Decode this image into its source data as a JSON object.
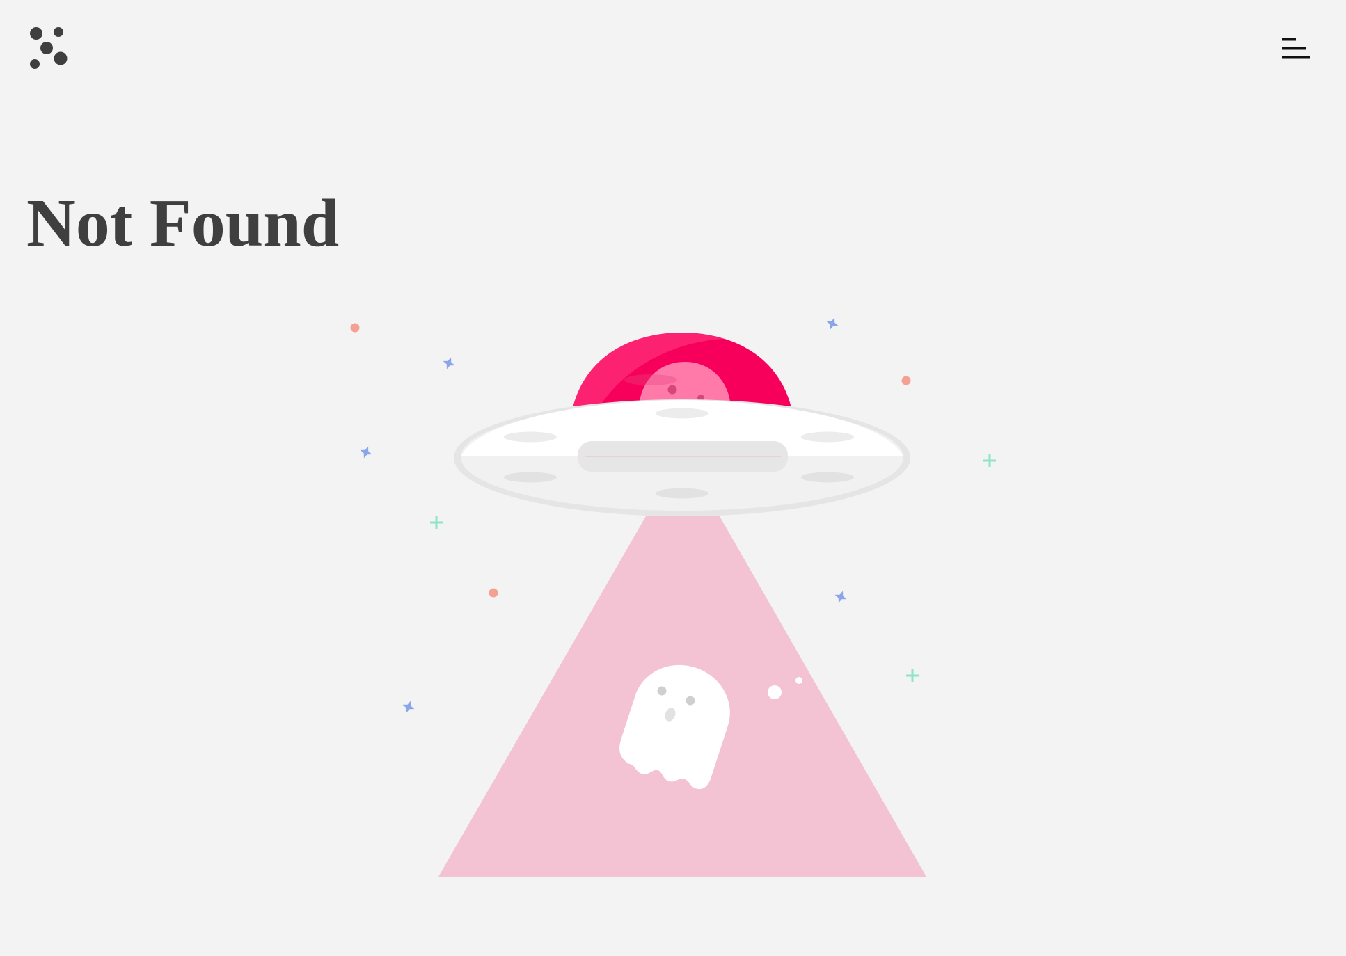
{
  "header": {
    "logo_icon": "dots-logo-icon",
    "menu_icon": "menu-icon"
  },
  "main": {
    "title": "Not Found"
  },
  "illustration": {
    "subject": "ufo-ghost-abduction",
    "colors": {
      "background": "#f3f3f3",
      "dome": "#f7005c",
      "dome_light": "#ff79a9",
      "saucer": "#ffffff",
      "saucer_shadow": "#e5e5e5",
      "beam": "#f3c2d3",
      "ghost": "#ffffff",
      "star_blue": "#8aa6ea",
      "star_green": "#8de4c8",
      "dot_salmon": "#f4a193",
      "text": "#3f3f3f"
    }
  }
}
